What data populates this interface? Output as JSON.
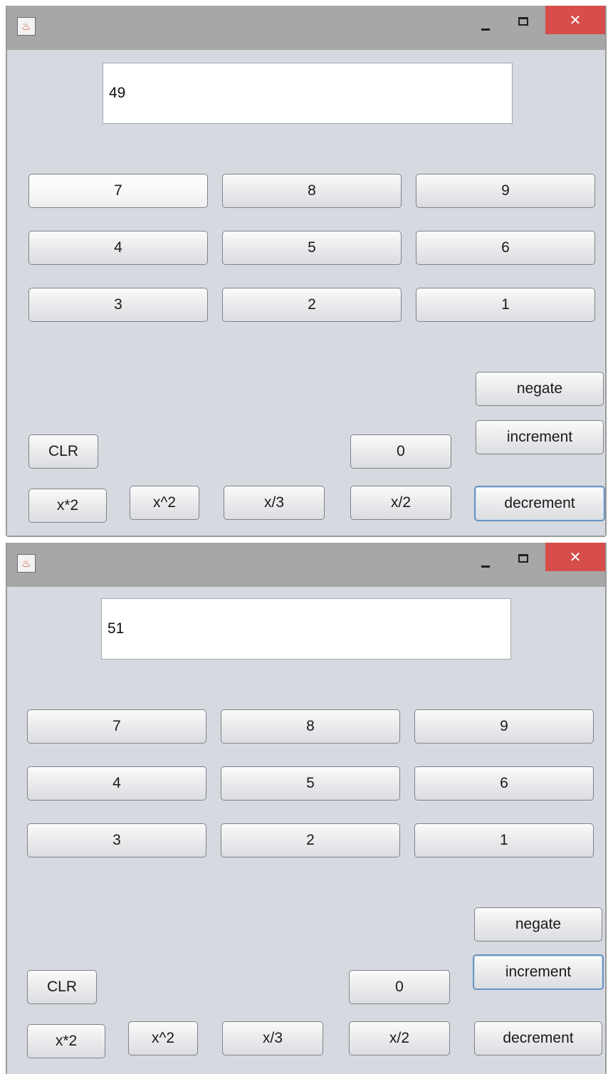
{
  "windows": [
    {
      "display_value": "49",
      "titlebar": {
        "close_glyph": "✕",
        "icon": "java-icon"
      },
      "digits_row1": [
        "7",
        "8",
        "9"
      ],
      "digits_row2": [
        "4",
        "5",
        "6"
      ],
      "digits_row3": [
        "3",
        "2",
        "1"
      ],
      "clr_label": "CLR",
      "zero_label": "0",
      "negate_label": "negate",
      "increment_label": "increment",
      "decrement_label": "decrement",
      "ops": [
        "x*2",
        "x^2",
        "x/3",
        "x/2"
      ],
      "focused_button": "decrement"
    },
    {
      "display_value": "51",
      "titlebar": {
        "close_glyph": "✕",
        "icon": "java-icon"
      },
      "digits_row1": [
        "7",
        "8",
        "9"
      ],
      "digits_row2": [
        "4",
        "5",
        "6"
      ],
      "digits_row3": [
        "3",
        "2",
        "1"
      ],
      "clr_label": "CLR",
      "zero_label": "0",
      "negate_label": "negate",
      "increment_label": "increment",
      "decrement_label": "decrement",
      "ops": [
        "x*2",
        "x^2",
        "x/3",
        "x/2"
      ],
      "focused_button": "increment"
    }
  ],
  "colors": {
    "window_bg": "#d6d9df",
    "titlebar_bg": "#a7a7a7",
    "close_bg": "#d64d4b",
    "focus_border": "#6a93c0"
  }
}
